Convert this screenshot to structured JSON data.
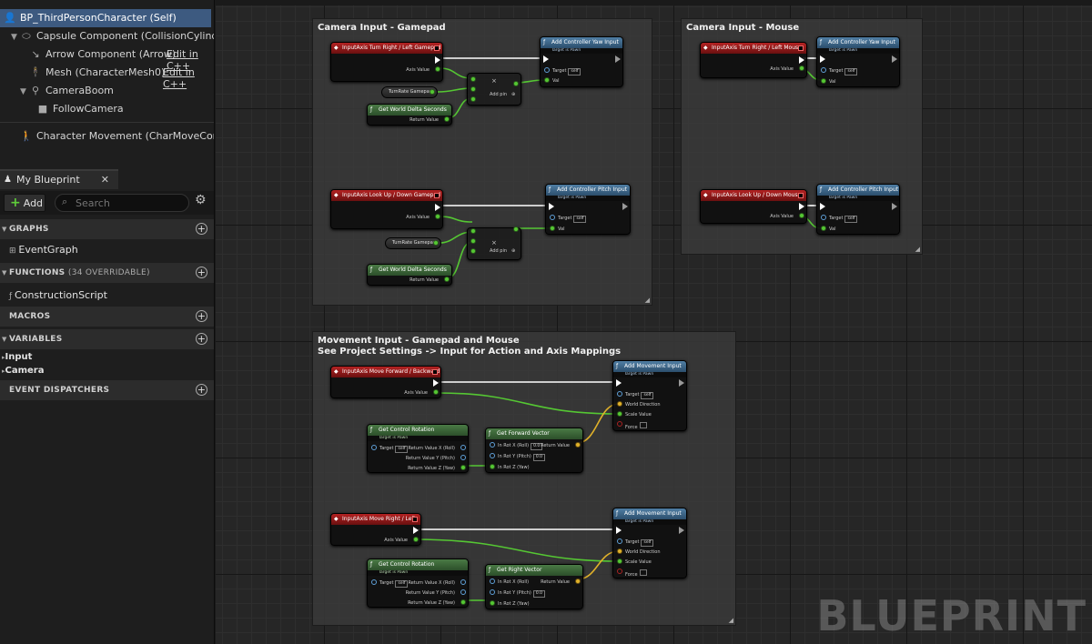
{
  "components": [
    {
      "label": "BP_ThirdPersonCharacter (Self)"
    },
    {
      "label": "Capsule Component (CollisionCylinder)"
    },
    {
      "label": "Arrow Component (Arrow)",
      "edit": "Edit in C++"
    },
    {
      "label": "Mesh (CharacterMesh0)",
      "edit": "Edit in C++"
    },
    {
      "label": "CameraBoom"
    },
    {
      "label": "FollowCamera"
    },
    {
      "label": "Character Movement (CharMoveComp)"
    }
  ],
  "my_blueprint": {
    "tab_label": "My Blueprint",
    "add_label": "Add",
    "search_placeholder": "Search",
    "graphs_label": "GRAPHS",
    "event_graph": "EventGraph",
    "functions_label": "FUNCTIONS",
    "functions_count": "(34 OVERRIDABLE)",
    "construction_script": "ConstructionScript",
    "macros_label": "MACROS",
    "variables_label": "VARIABLES",
    "variables": [
      "Input",
      "Camera"
    ],
    "dispatchers_label": "EVENT DISPATCHERS"
  },
  "graph": {
    "watermark": "BLUEPRINT",
    "comments": {
      "gamepad": "Camera Input - Gamepad",
      "mouse": "Camera Input - Mouse",
      "movement": "Movement Input - Gamepad and Mouse\nSee Project Settings -> Input for Action and Axis Mappings"
    },
    "nodes": {
      "turn_gamepad": "InputAxis Turn Right / Left Gamepad",
      "lookup_gamepad": "InputAxis Look Up / Down Gamepad",
      "turn_mouse": "InputAxis Turn Right / Left Mouse",
      "lookup_mouse": "InputAxis Look Up / Down Mouse",
      "move_forward": "InputAxis Move Forward / Backward",
      "move_right": "InputAxis Move Right / Left",
      "yaw_input": "Add Controller Yaw Input",
      "pitch_input": "Add Controller Pitch Input",
      "movement_input": "Add Movement Input",
      "target_is_pawn": "Target is Pawn",
      "get_world_delta": "Get World Delta Seconds",
      "get_control_rotation": "Get Control Rotation",
      "get_forward_vector": "Get Forward Vector",
      "get_right_vector": "Get Right Vector",
      "turn_rate_gamepad": "TurnRate Gamepad",
      "add_pin": "Add pin",
      "multiply": "×"
    },
    "pins": {
      "axis_value": "Axis Value",
      "return_value": "Return Value",
      "target": "Target",
      "self": "self",
      "val": "Val",
      "world_direction": "World Direction",
      "scale_value": "Scale Value",
      "force": "Force",
      "rv_x": "Return Value X (Roll)",
      "rv_y": "Return Value Y (Pitch)",
      "rv_z": "Return Value Z (Yaw)",
      "in_x": "In Rot X (Roll)",
      "in_y": "In Rot Y (Pitch)",
      "in_z": "In Rot Z (Yaw)",
      "zero": "0.0"
    }
  }
}
